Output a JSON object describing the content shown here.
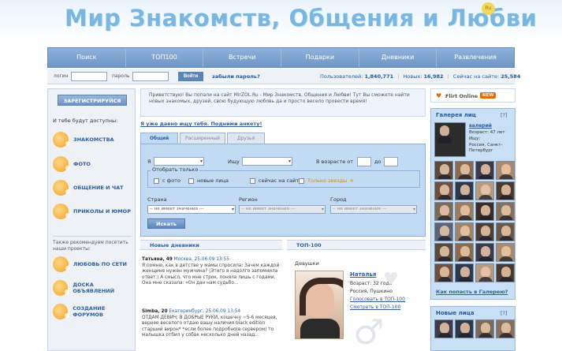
{
  "site": {
    "title": "Мир Знакомств, Общения и Любви",
    "logo_badge": "Ru"
  },
  "nav": {
    "items": [
      {
        "label": "Поиск"
      },
      {
        "label": "ТОП100"
      },
      {
        "label": "Встречи"
      },
      {
        "label": "Подарки"
      },
      {
        "label": "Дневники"
      },
      {
        "label": "Развлечения"
      }
    ]
  },
  "login": {
    "login_label": "логин",
    "password_label": "пароль",
    "login_value": "",
    "password_value": "",
    "submit_label": "Войти",
    "forgot_label": "забыли пароль?"
  },
  "stats": {
    "users_label": "Пользователей:",
    "users_value": "1,840,771",
    "new_label": "Новых:",
    "new_value": "16,982",
    "online_label": "Сейчас на сайте:",
    "online_value": "25,584"
  },
  "sidebar": {
    "register_label": "ЗАРЕГИСТРИРУЙСЯ",
    "available_text": "И тебе будут доступны:",
    "features": [
      {
        "label": "ЗНАКОМСТВА",
        "icon": "hearts-icon"
      },
      {
        "label": "ФОТО",
        "icon": "camera-icon"
      },
      {
        "label": "ОБЩЕНИЕ И ЧАТ",
        "icon": "chat-icon"
      },
      {
        "label": "ПРИКОЛЫ И ЮМОР",
        "icon": "smile-icon"
      }
    ],
    "recommend_text": "Также рекомендуем посетить наши проекты:",
    "projects": [
      {
        "label": "ЛЮБОВЬ ПО СЕТИ",
        "icon": "heart-icon"
      },
      {
        "label": "ДОСКА ОБЪЯВЛЕНИЙ",
        "icon": "board-icon"
      },
      {
        "label": "СОЗДАНИЕ ФОРУМОВ",
        "icon": "forum-icon"
      }
    ]
  },
  "welcome": {
    "text": "Приветствую! Вы попали на сайт MirZOL.Ru - Мир Знакомств, Общения и Любви! Тут Вы сможете найти новых знакомых, друзей, свою будующую любовь да и просто весело провести время!"
  },
  "search": {
    "anketa_link": "Я уже давно ищу тебя. Подними анкету!",
    "tabs": [
      {
        "label": "Общий"
      },
      {
        "label": "Расширенный"
      },
      {
        "label": "Друзья"
      }
    ],
    "i_label": "Я",
    "seek_label": "Ищу",
    "age_from_label": "В возрасте от",
    "age_to_label": "до",
    "only_title": "Отобрать только",
    "checkboxes": [
      {
        "label": "с фото"
      },
      {
        "label": "новые лица"
      },
      {
        "label": "сейчас на сайте"
      },
      {
        "label": "Только звезды"
      }
    ],
    "country_label": "Страна",
    "region_label": "Регион",
    "city_label": "Город",
    "no_value": "-- не имеет значения ---",
    "submit_label": "Искать"
  },
  "diaries": {
    "title": "Новые дневники",
    "entries": [
      {
        "author": "Татьяна, 49",
        "meta": "Москва, 25.06.09 13:55",
        "text": "Я помню, как в детстве у мамы спросила: Зачем каждой женщине нужен мужчина? (Этого я надолго запомнила ответ.) А смысл, что мне строк, поняла лишь с годами. Она мне сказала: «Он дан нам судьбо..."
      },
      {
        "author": "Simba, 20",
        "meta": "Екатеринбург, 25.06.09 13:54",
        "text": "ОТДАМ ДЕВИЧ, В ДОБРЫЕ РУКИ, кошечку ~5-6 месяцев, вернее веселого отдаю вашу наличия black edition старший вирон* *если более подробно(в сервером) то малышка отбил у собак несколько дней назад..."
      }
    ]
  },
  "top100": {
    "title": "ТОП-100",
    "section": "Девушки",
    "person": {
      "name": "Наталья",
      "age": "Возраст: 32 года",
      "location": "Россия, Пушкино",
      "vote": "Голосовать в ТОП-100",
      "view": "Смотреть в ТОП-100"
    }
  },
  "right": {
    "flirt_label": "Flirt Online",
    "flirt_badge": "NEW",
    "gallery_title": "Галерея лиц",
    "gallery_help": "[?]",
    "featured": {
      "name": "валерий",
      "age": "Возраст: 47 лет",
      "seek": "Ищу:",
      "location": "Россия, Санкт-Петербург"
    },
    "gallery_link": "Как попасть в Галерею?",
    "new_faces_title": "Новые лица",
    "new_faces_help": "[?]"
  },
  "colors": {
    "nav": "#7fa3d0",
    "logo": "#79b6e0",
    "link": "#2d5f9c",
    "search_bg": "#c2daf3"
  }
}
